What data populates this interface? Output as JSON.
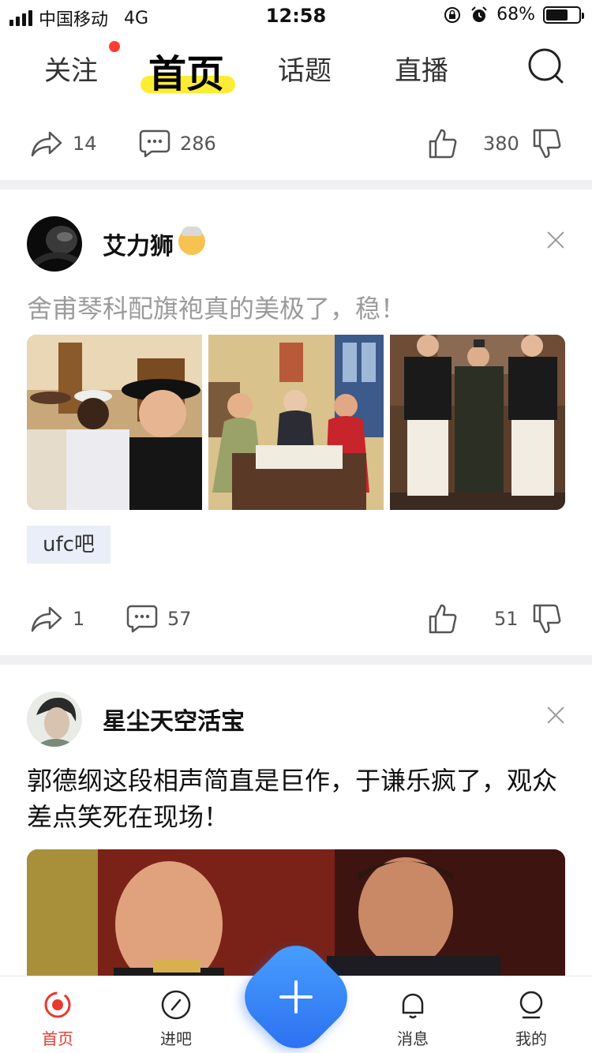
{
  "status_bar": {
    "carrier": "中国移动",
    "network": "4G",
    "time": "12:58",
    "battery_percent": "68%",
    "battery_level": 0.68
  },
  "top_tabs": {
    "follow": "关注",
    "home": "首页",
    "topics": "话题",
    "live": "直播",
    "search_icon": "search-icon",
    "follow_has_dot": true
  },
  "posts": [
    {
      "actions": {
        "share": "14",
        "comment": "286",
        "like": "380"
      }
    },
    {
      "author": "艾力狮",
      "author_emoji": "old-man-emoji",
      "text": "舍甫琴科配旗袍真的美极了，稳！",
      "tag": "ufc吧",
      "actions": {
        "share": "1",
        "comment": "57",
        "like": "51"
      }
    },
    {
      "author": "星尘天空活宝",
      "text": "郭德纲这段相声简直是巨作，于谦乐疯了，观众差点笑死在现场！"
    }
  ],
  "bottom_nav": {
    "home": "首页",
    "forum": "进吧",
    "messages": "消息",
    "me": "我的",
    "active": "home"
  },
  "colors": {
    "accent_red": "#e8392f",
    "highlight_yellow": "#fdec34",
    "fab_blue": "#2a6cf0",
    "tag_bg": "#e9eef8"
  }
}
